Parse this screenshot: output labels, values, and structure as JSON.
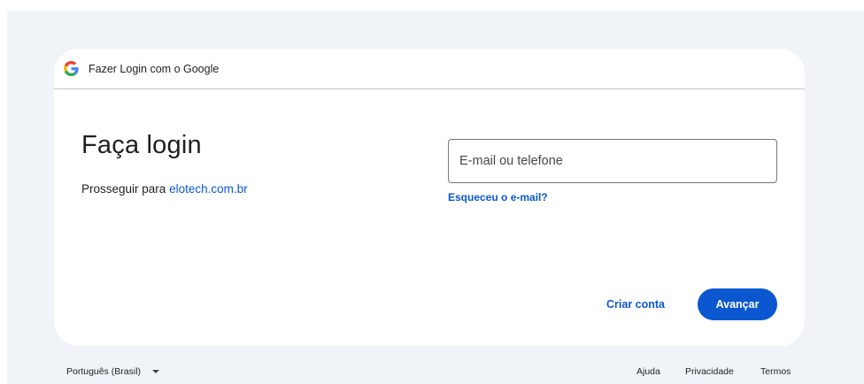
{
  "header": {
    "logo_icon": "google-g-icon",
    "title": "Fazer Login com o Google"
  },
  "main": {
    "title": "Faça login",
    "subtitle_prefix": "Prosseguir para",
    "subtitle_link": "elotech.com.br"
  },
  "form": {
    "email_placeholder": "E-mail ou telefone",
    "email_value": "",
    "forgot_link": "Esqueceu o e-mail?",
    "create_account": "Criar conta",
    "next": "Avançar"
  },
  "footer": {
    "language": "Português (Brasil)",
    "language_icon": "caret-down-icon",
    "help": "Ajuda",
    "privacy": "Privacidade",
    "terms": "Termos"
  },
  "colors": {
    "accent": "#0b57d0",
    "page_bg": "#f0f4f9",
    "card_bg": "#ffffff",
    "text": "#1f1f1f"
  }
}
